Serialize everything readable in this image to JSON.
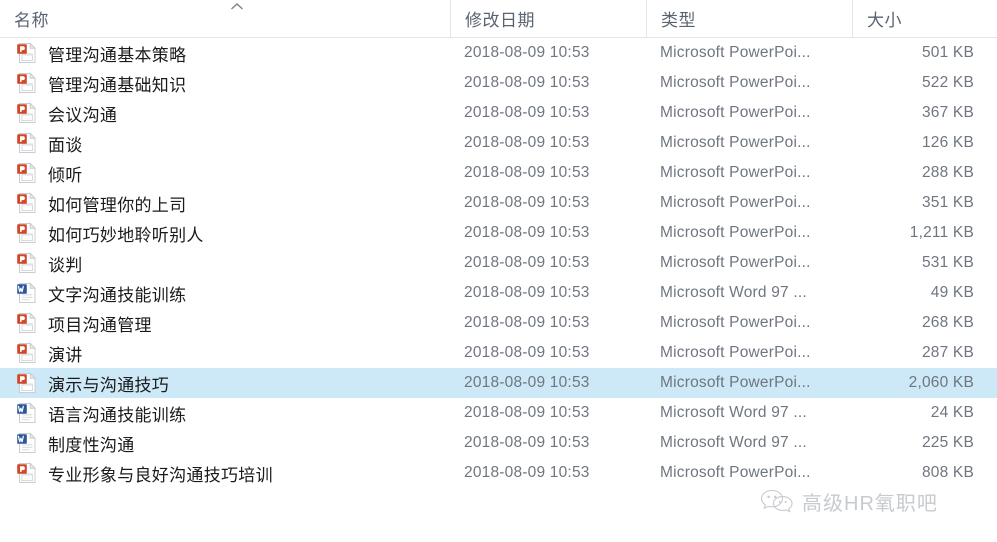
{
  "columns": {
    "name": {
      "label": "名称",
      "sort": "ascending",
      "sort_icon": "chevron-up-icon"
    },
    "date": {
      "label": "修改日期"
    },
    "type": {
      "label": "类型"
    },
    "size": {
      "label": "大小"
    }
  },
  "files": [
    {
      "name": "管理沟通基本策略",
      "date": "2018-08-09 10:53",
      "type": "Microsoft PowerPoi...",
      "size": "501 KB",
      "icon": "powerpoint-file-icon",
      "selected": false
    },
    {
      "name": "管理沟通基础知识",
      "date": "2018-08-09 10:53",
      "type": "Microsoft PowerPoi...",
      "size": "522 KB",
      "icon": "powerpoint-file-icon",
      "selected": false
    },
    {
      "name": "会议沟通",
      "date": "2018-08-09 10:53",
      "type": "Microsoft PowerPoi...",
      "size": "367 KB",
      "icon": "powerpoint-file-icon",
      "selected": false
    },
    {
      "name": "面谈",
      "date": "2018-08-09 10:53",
      "type": "Microsoft PowerPoi...",
      "size": "126 KB",
      "icon": "powerpoint-file-icon",
      "selected": false
    },
    {
      "name": "倾听",
      "date": "2018-08-09 10:53",
      "type": "Microsoft PowerPoi...",
      "size": "288 KB",
      "icon": "powerpoint-file-icon",
      "selected": false
    },
    {
      "name": "如何管理你的上司",
      "date": "2018-08-09 10:53",
      "type": "Microsoft PowerPoi...",
      "size": "351 KB",
      "icon": "powerpoint-file-icon",
      "selected": false
    },
    {
      "name": "如何巧妙地聆听别人",
      "date": "2018-08-09 10:53",
      "type": "Microsoft PowerPoi...",
      "size": "1,211 KB",
      "icon": "powerpoint-file-icon",
      "selected": false
    },
    {
      "name": "谈判",
      "date": "2018-08-09 10:53",
      "type": "Microsoft PowerPoi...",
      "size": "531 KB",
      "icon": "powerpoint-file-icon",
      "selected": false
    },
    {
      "name": "文字沟通技能训练",
      "date": "2018-08-09 10:53",
      "type": "Microsoft Word 97 ...",
      "size": "49 KB",
      "icon": "word-file-icon",
      "selected": false
    },
    {
      "name": "项目沟通管理",
      "date": "2018-08-09 10:53",
      "type": "Microsoft PowerPoi...",
      "size": "268 KB",
      "icon": "powerpoint-file-icon",
      "selected": false
    },
    {
      "name": "演讲",
      "date": "2018-08-09 10:53",
      "type": "Microsoft PowerPoi...",
      "size": "287 KB",
      "icon": "powerpoint-file-icon",
      "selected": false
    },
    {
      "name": "演示与沟通技巧",
      "date": "2018-08-09 10:53",
      "type": "Microsoft PowerPoi...",
      "size": "2,060 KB",
      "icon": "powerpoint-file-icon",
      "selected": true
    },
    {
      "name": "语言沟通技能训练",
      "date": "2018-08-09 10:53",
      "type": "Microsoft Word 97 ...",
      "size": "24 KB",
      "icon": "word-file-icon",
      "selected": false
    },
    {
      "name": "制度性沟通",
      "date": "2018-08-09 10:53",
      "type": "Microsoft Word 97 ...",
      "size": "225 KB",
      "icon": "word-file-icon",
      "selected": false
    },
    {
      "name": "专业形象与良好沟通技巧培训",
      "date": "2018-08-09 10:53",
      "type": "Microsoft PowerPoi...",
      "size": "808 KB",
      "icon": "powerpoint-file-icon",
      "selected": false
    }
  ],
  "watermark": {
    "text": "高级HR氧职吧",
    "logo": "wechat-logo-icon"
  },
  "colors": {
    "selection": "#cde8f7",
    "powerpoint": "#d24726",
    "word": "#2b579a",
    "header_text": "#5a6471",
    "name_text": "#1b1b1b",
    "meta_text": "#6f7680"
  }
}
